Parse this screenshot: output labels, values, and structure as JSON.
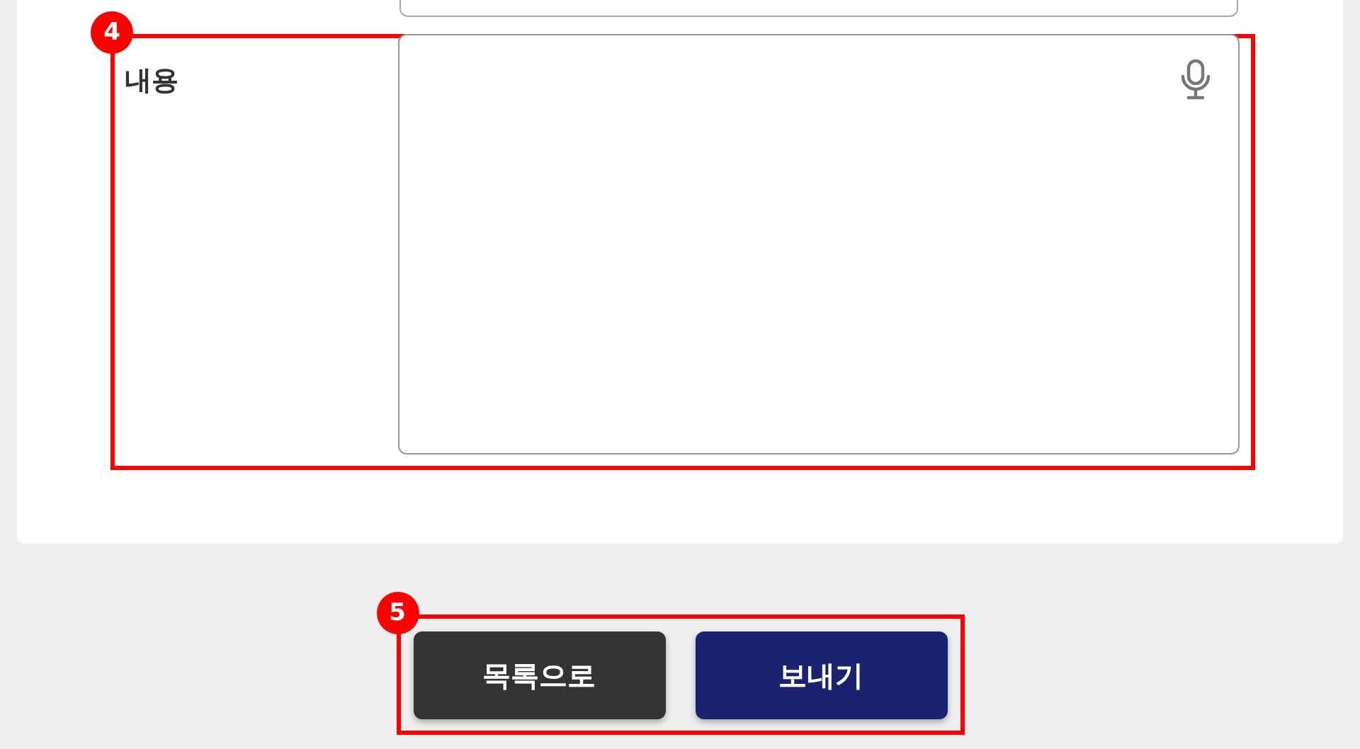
{
  "annotations": [
    {
      "number": "4"
    },
    {
      "number": "5"
    }
  ],
  "content_field": {
    "label": "내용"
  },
  "buttons": [
    {
      "label": "목록으로",
      "kind": "secondary"
    },
    {
      "label": "보내기",
      "kind": "primary"
    }
  ]
}
